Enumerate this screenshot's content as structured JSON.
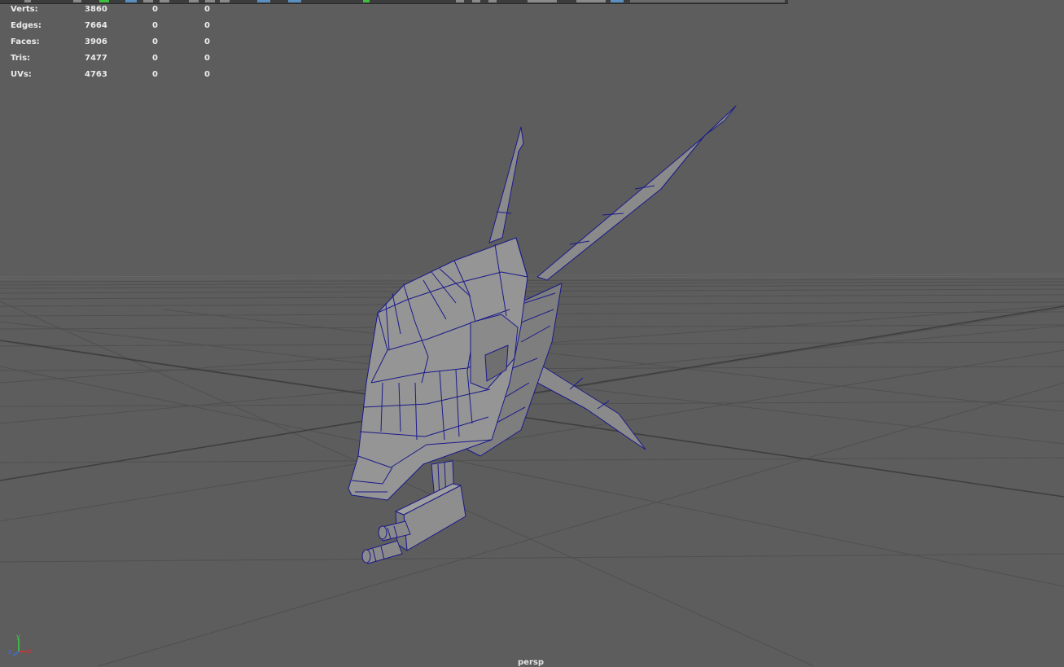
{
  "hud": {
    "rows": [
      {
        "label": "Verts:",
        "v1": "3860",
        "v2": "0",
        "v3": "0"
      },
      {
        "label": "Edges:",
        "v1": "7664",
        "v2": "0",
        "v3": "0"
      },
      {
        "label": "Faces:",
        "v1": "3906",
        "v2": "0",
        "v3": "0"
      },
      {
        "label": "Tris:",
        "v1": "7477",
        "v2": "0",
        "v3": "0"
      },
      {
        "label": "UVs:",
        "v1": "4763",
        "v2": "0",
        "v3": "0"
      }
    ]
  },
  "viewport": {
    "camera": "persp",
    "background_color": "#5d5d5d",
    "grid_color": "#4a4a4a",
    "wireframe_color": "#1a1a8c",
    "mesh_color": "#8f8f8f"
  },
  "axis": {
    "y": "y",
    "x": "x",
    "z": "z"
  }
}
